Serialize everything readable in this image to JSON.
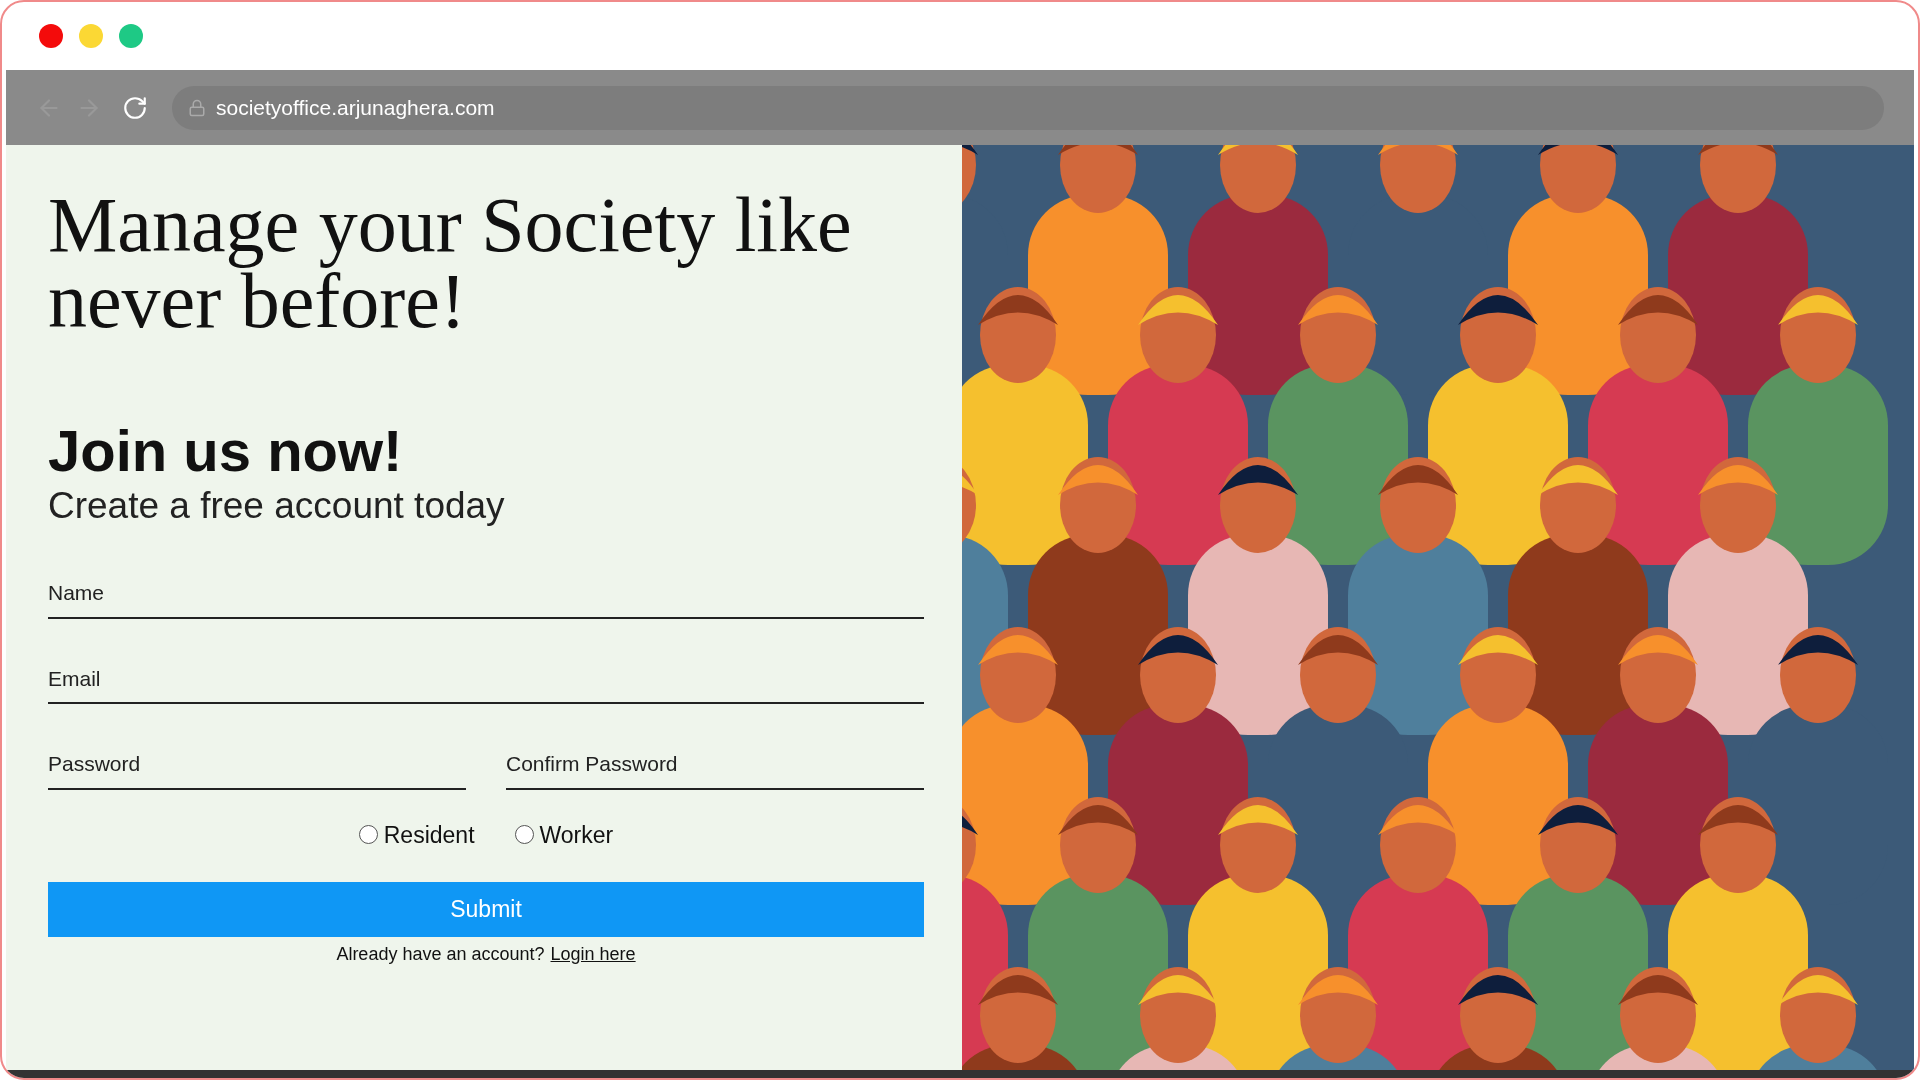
{
  "browser": {
    "url": "societyoffice.arjunaghera.com",
    "back_disabled": true,
    "forward_disabled": true
  },
  "heading": "Manage your Society like never before!",
  "subheading": "Join us now!",
  "tagline": "Create a free account today",
  "fields": [
    {
      "placeholder": "Name",
      "kind": "wide"
    },
    {
      "placeholder": "Email",
      "kind": "wide"
    },
    {
      "placeholder": "Password",
      "kind": "half"
    },
    {
      "placeholder": "Confirm Password",
      "kind": "half"
    }
  ],
  "roles": [
    {
      "label": "Resident",
      "selected": false
    },
    {
      "label": "Worker",
      "selected": false
    }
  ],
  "submit": "Submit",
  "login_prompt": "Already have an account?",
  "login_link": "Login here"
}
